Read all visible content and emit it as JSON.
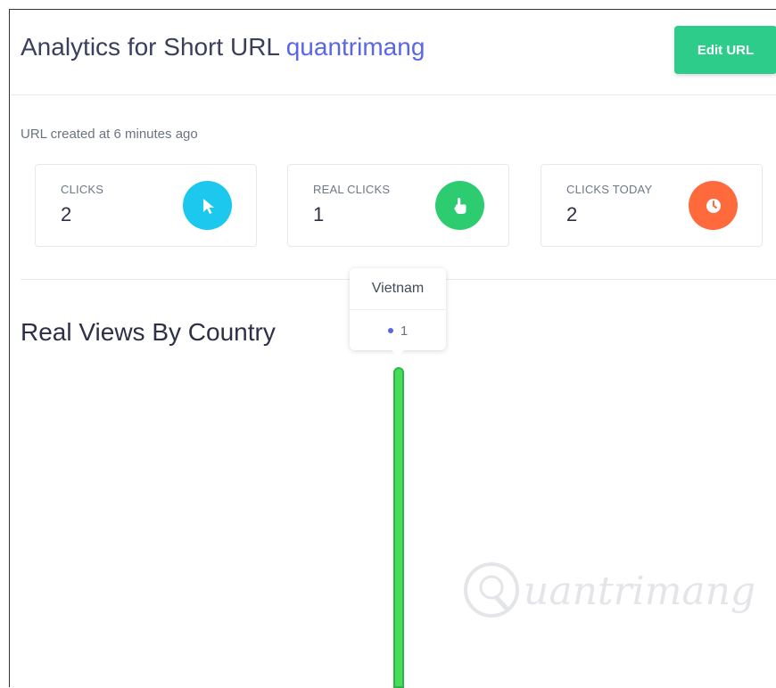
{
  "header": {
    "title_prefix": "Analytics for Short URL",
    "title_link": "quantrimang",
    "edit_button": "Edit URL"
  },
  "created_text": "URL created at 6 minutes ago",
  "stats": [
    {
      "label": "CLICKS",
      "value": "2",
      "icon": "cursor-pointer-icon",
      "color": "#1cc8ee"
    },
    {
      "label": "REAL CLICKS",
      "value": "1",
      "icon": "hand-pointer-icon",
      "color": "#2ecc71"
    },
    {
      "label": "CLICKS TODAY",
      "value": "2",
      "icon": "clock-icon",
      "color": "#ff6a3d"
    }
  ],
  "section_title": "Real Views By Country",
  "chart_data": {
    "type": "bar",
    "categories": [
      "Vietnam"
    ],
    "series": [
      {
        "values": [
          1
        ]
      }
    ],
    "tooltip": {
      "title": "Vietnam",
      "value": "1"
    },
    "bar_color": "#47dd5c"
  },
  "watermark": {
    "text": "uantrimang"
  }
}
